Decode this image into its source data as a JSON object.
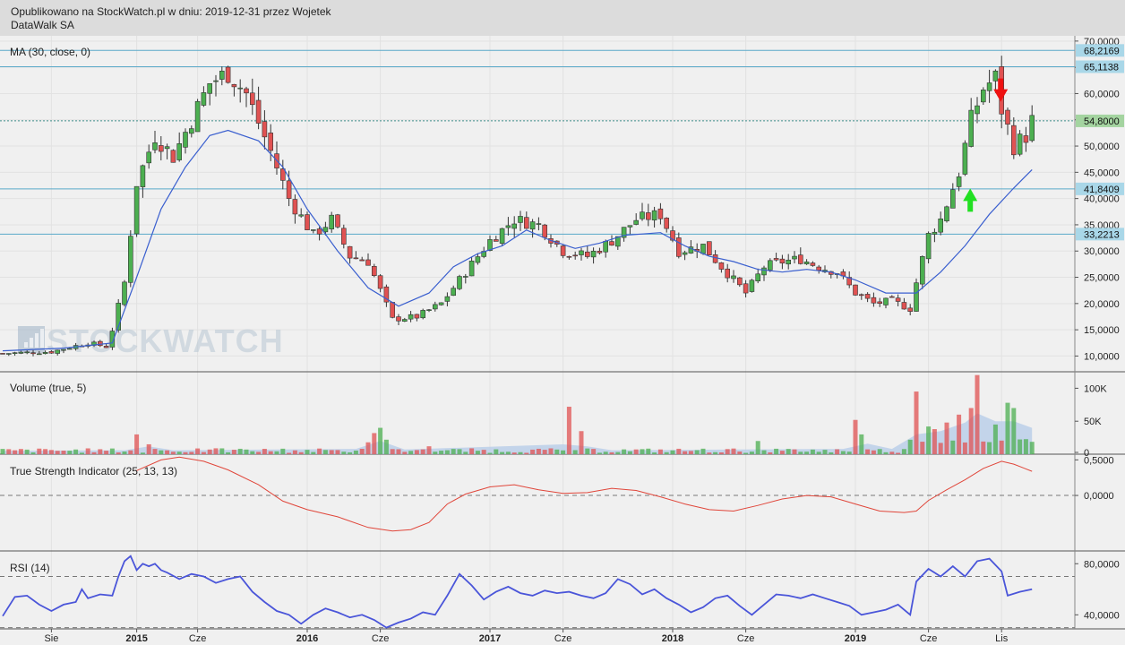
{
  "header": {
    "published": "Opublikowano na StockWatch.pl w dniu: 2019-12-31 przez Wojetek",
    "company": "DataWalk SA"
  },
  "watermark": "STOCKWATCH",
  "colors": {
    "up": "#4caf50",
    "down": "#e05252",
    "ma": "#3a5fcf",
    "tsi": "#e0463a",
    "rsi": "#4a55d9",
    "hline": "#5aa9c9",
    "volume_ma": "#b8cde8"
  },
  "chart_data": [
    {
      "type": "candlestick",
      "title": "MA (30, close, 0)",
      "ylim": [
        7000,
        71000
      ],
      "y_ticks": [
        "70,0000",
        "65,0000",
        "60,0000",
        "55,0000",
        "50,0000",
        "45,0000",
        "40,0000",
        "35,0000",
        "30,0000",
        "25,0000",
        "20,0000",
        "15,0000",
        "10,0000"
      ],
      "x_ticks": [
        "Sie",
        "2015",
        "Cze",
        "2016",
        "Cze",
        "2017",
        "Cze",
        "2018",
        "Cze",
        "2019",
        "Cze",
        "Lis"
      ],
      "horizontal_lines": [
        {
          "value": 68216.9,
          "label": "68,2169"
        },
        {
          "value": 65113.8,
          "label": "65,1138"
        },
        {
          "value": 41840.9,
          "label": "41,8409"
        },
        {
          "value": 33221.3,
          "label": "33,2213"
        }
      ],
      "last_price": {
        "value": 54800,
        "label": "54,8000"
      },
      "close_path": [
        [
          0,
          10500
        ],
        [
          8,
          10800
        ],
        [
          14,
          12500
        ],
        [
          17,
          11800
        ],
        [
          18,
          15000
        ],
        [
          20,
          24000
        ],
        [
          22,
          43000
        ],
        [
          25,
          52000
        ],
        [
          28,
          48000
        ],
        [
          31,
          55000
        ],
        [
          34,
          62000
        ],
        [
          37,
          64000
        ],
        [
          40,
          60000
        ],
        [
          44,
          49000
        ],
        [
          47,
          40000
        ],
        [
          51,
          33000
        ],
        [
          54,
          36000
        ],
        [
          57,
          29000
        ],
        [
          60,
          28000
        ],
        [
          64,
          17000
        ],
        [
          68,
          17500
        ],
        [
          72,
          20000
        ],
        [
          76,
          26000
        ],
        [
          80,
          32000
        ],
        [
          84,
          36000
        ],
        [
          88,
          35000
        ],
        [
          92,
          30000
        ],
        [
          96,
          29000
        ],
        [
          100,
          32000
        ],
        [
          104,
          36000
        ],
        [
          108,
          37000
        ],
        [
          111,
          30000
        ],
        [
          115,
          31000
        ],
        [
          118,
          27000
        ],
        [
          122,
          22000
        ],
        [
          125,
          27000
        ],
        [
          128,
          28000
        ],
        [
          131,
          28500
        ],
        [
          134,
          27000
        ],
        [
          137,
          26000
        ],
        [
          140,
          22000
        ],
        [
          143,
          20000
        ],
        [
          146,
          20500
        ],
        [
          149,
          19000
        ],
        [
          150,
          24000
        ],
        [
          152,
          33000
        ],
        [
          154,
          36000
        ],
        [
          157,
          45000
        ],
        [
          159,
          55000
        ],
        [
          161,
          61000
        ],
        [
          163,
          63000
        ],
        [
          164,
          57000
        ],
        [
          166,
          50000
        ],
        [
          168,
          52000
        ],
        [
          169,
          54800
        ]
      ],
      "ma_path": [
        [
          0,
          11000
        ],
        [
          10,
          11500
        ],
        [
          18,
          12500
        ],
        [
          22,
          25000
        ],
        [
          26,
          38000
        ],
        [
          30,
          46000
        ],
        [
          34,
          52000
        ],
        [
          37,
          53000
        ],
        [
          42,
          51000
        ],
        [
          46,
          46000
        ],
        [
          50,
          38000
        ],
        [
          55,
          30000
        ],
        [
          60,
          23000
        ],
        [
          65,
          19500
        ],
        [
          70,
          22000
        ],
        [
          74,
          27000
        ],
        [
          78,
          29500
        ],
        [
          82,
          31000
        ],
        [
          86,
          34000
        ],
        [
          90,
          32000
        ],
        [
          94,
          30500
        ],
        [
          98,
          31500
        ],
        [
          102,
          33000
        ],
        [
          108,
          33500
        ],
        [
          112,
          31000
        ],
        [
          116,
          29000
        ],
        [
          120,
          28000
        ],
        [
          124,
          26500
        ],
        [
          128,
          26000
        ],
        [
          132,
          26500
        ],
        [
          136,
          26000
        ],
        [
          140,
          24500
        ],
        [
          145,
          22000
        ],
        [
          150,
          22000
        ],
        [
          154,
          26000
        ],
        [
          158,
          31000
        ],
        [
          162,
          37000
        ],
        [
          166,
          42000
        ],
        [
          169,
          45500
        ]
      ],
      "signals": [
        {
          "t": 159,
          "type": "buy"
        },
        {
          "t": 164,
          "type": "sell"
        }
      ]
    },
    {
      "type": "bar",
      "title": "Volume (true, 5)",
      "ylim": [
        0,
        125000
      ],
      "y_ticks": [
        "100K",
        "50K",
        "0"
      ],
      "spikes": [
        [
          22,
          30000
        ],
        [
          24,
          15000
        ],
        [
          25,
          8000
        ],
        [
          60,
          18000
        ],
        [
          61,
          32000
        ],
        [
          62,
          40000
        ],
        [
          63,
          22000
        ],
        [
          70,
          12000
        ],
        [
          93,
          72000
        ],
        [
          95,
          35000
        ],
        [
          124,
          20000
        ],
        [
          140,
          52000
        ],
        [
          141,
          30000
        ],
        [
          150,
          95000
        ],
        [
          152,
          42000
        ],
        [
          153,
          38000
        ],
        [
          155,
          48000
        ],
        [
          157,
          60000
        ],
        [
          159,
          70000
        ],
        [
          160,
          120000
        ],
        [
          163,
          45000
        ],
        [
          165,
          78000
        ],
        [
          166,
          70000
        ]
      ],
      "volume_ma_path": [
        [
          0,
          5000
        ],
        [
          20,
          6000
        ],
        [
          24,
          12000
        ],
        [
          28,
          6000
        ],
        [
          58,
          8000
        ],
        [
          62,
          20000
        ],
        [
          66,
          7000
        ],
        [
          92,
          15000
        ],
        [
          96,
          12000
        ],
        [
          100,
          6000
        ],
        [
          138,
          8000
        ],
        [
          142,
          16000
        ],
        [
          146,
          8000
        ],
        [
          150,
          30000
        ],
        [
          154,
          35000
        ],
        [
          158,
          48000
        ],
        [
          160,
          62000
        ],
        [
          163,
          50000
        ],
        [
          166,
          50000
        ],
        [
          169,
          40000
        ]
      ]
    },
    {
      "type": "line",
      "title": "True Strength Indicator (25, 13, 13)",
      "ylim": [
        -0.78,
        0.58
      ],
      "y_ticks": [
        "0,5000",
        "0,0000"
      ],
      "reference_lines": [
        0
      ],
      "path": [
        [
          22,
          0.35
        ],
        [
          26,
          0.5
        ],
        [
          29,
          0.54
        ],
        [
          33,
          0.48
        ],
        [
          37,
          0.36
        ],
        [
          42,
          0.15
        ],
        [
          46,
          -0.08
        ],
        [
          50,
          -0.2
        ],
        [
          55,
          -0.3
        ],
        [
          60,
          -0.45
        ],
        [
          64,
          -0.5
        ],
        [
          67,
          -0.48
        ],
        [
          70,
          -0.38
        ],
        [
          73,
          -0.12
        ],
        [
          76,
          0.02
        ],
        [
          80,
          0.12
        ],
        [
          84,
          0.15
        ],
        [
          88,
          0.08
        ],
        [
          92,
          0.03
        ],
        [
          96,
          0.04
        ],
        [
          100,
          0.1
        ],
        [
          104,
          0.07
        ],
        [
          108,
          -0.02
        ],
        [
          112,
          -0.12
        ],
        [
          116,
          -0.2
        ],
        [
          120,
          -0.22
        ],
        [
          124,
          -0.14
        ],
        [
          128,
          -0.05
        ],
        [
          132,
          0.0
        ],
        [
          136,
          -0.02
        ],
        [
          140,
          -0.12
        ],
        [
          144,
          -0.22
        ],
        [
          148,
          -0.24
        ],
        [
          150,
          -0.22
        ],
        [
          152,
          -0.07
        ],
        [
          155,
          0.08
        ],
        [
          158,
          0.22
        ],
        [
          161,
          0.38
        ],
        [
          164,
          0.48
        ],
        [
          166,
          0.44
        ],
        [
          169,
          0.34
        ]
      ]
    },
    {
      "type": "line",
      "title": "RSI (14)",
      "ylim": [
        29,
        90
      ],
      "y_ticks": [
        "80,0000",
        "40,0000"
      ],
      "reference_lines": [
        70,
        30
      ],
      "path": [
        [
          0,
          39
        ],
        [
          2,
          54
        ],
        [
          4,
          55
        ],
        [
          6,
          48
        ],
        [
          8,
          43
        ],
        [
          10,
          48
        ],
        [
          12,
          50
        ],
        [
          13,
          60
        ],
        [
          14,
          53
        ],
        [
          16,
          56
        ],
        [
          18,
          55
        ],
        [
          19,
          70
        ],
        [
          20,
          82
        ],
        [
          21,
          86
        ],
        [
          22,
          75
        ],
        [
          23,
          80
        ],
        [
          24,
          78
        ],
        [
          25,
          80
        ],
        [
          26,
          75
        ],
        [
          27,
          73
        ],
        [
          29,
          68
        ],
        [
          31,
          72
        ],
        [
          33,
          70
        ],
        [
          35,
          65
        ],
        [
          37,
          68
        ],
        [
          39,
          70
        ],
        [
          41,
          58
        ],
        [
          43,
          50
        ],
        [
          45,
          43
        ],
        [
          47,
          40
        ],
        [
          49,
          33
        ],
        [
          51,
          40
        ],
        [
          53,
          45
        ],
        [
          55,
          42
        ],
        [
          57,
          38
        ],
        [
          59,
          40
        ],
        [
          61,
          36
        ],
        [
          63,
          30
        ],
        [
          65,
          34
        ],
        [
          67,
          37
        ],
        [
          69,
          42
        ],
        [
          71,
          40
        ],
        [
          73,
          55
        ],
        [
          75,
          72
        ],
        [
          77,
          63
        ],
        [
          79,
          52
        ],
        [
          81,
          58
        ],
        [
          83,
          62
        ],
        [
          85,
          57
        ],
        [
          87,
          55
        ],
        [
          89,
          59
        ],
        [
          91,
          57
        ],
        [
          93,
          58
        ],
        [
          95,
          55
        ],
        [
          97,
          53
        ],
        [
          99,
          57
        ],
        [
          101,
          68
        ],
        [
          103,
          64
        ],
        [
          105,
          56
        ],
        [
          107,
          60
        ],
        [
          109,
          53
        ],
        [
          111,
          48
        ],
        [
          113,
          42
        ],
        [
          115,
          46
        ],
        [
          117,
          53
        ],
        [
          119,
          55
        ],
        [
          121,
          47
        ],
        [
          123,
          40
        ],
        [
          125,
          48
        ],
        [
          127,
          56
        ],
        [
          129,
          55
        ],
        [
          131,
          53
        ],
        [
          133,
          56
        ],
        [
          135,
          53
        ],
        [
          137,
          50
        ],
        [
          139,
          47
        ],
        [
          141,
          40
        ],
        [
          143,
          42
        ],
        [
          145,
          44
        ],
        [
          147,
          48
        ],
        [
          149,
          40
        ],
        [
          150,
          66
        ],
        [
          152,
          76
        ],
        [
          154,
          70
        ],
        [
          156,
          78
        ],
        [
          158,
          70
        ],
        [
          160,
          82
        ],
        [
          162,
          84
        ],
        [
          164,
          74
        ],
        [
          165,
          55
        ],
        [
          167,
          58
        ],
        [
          169,
          60
        ]
      ]
    }
  ]
}
